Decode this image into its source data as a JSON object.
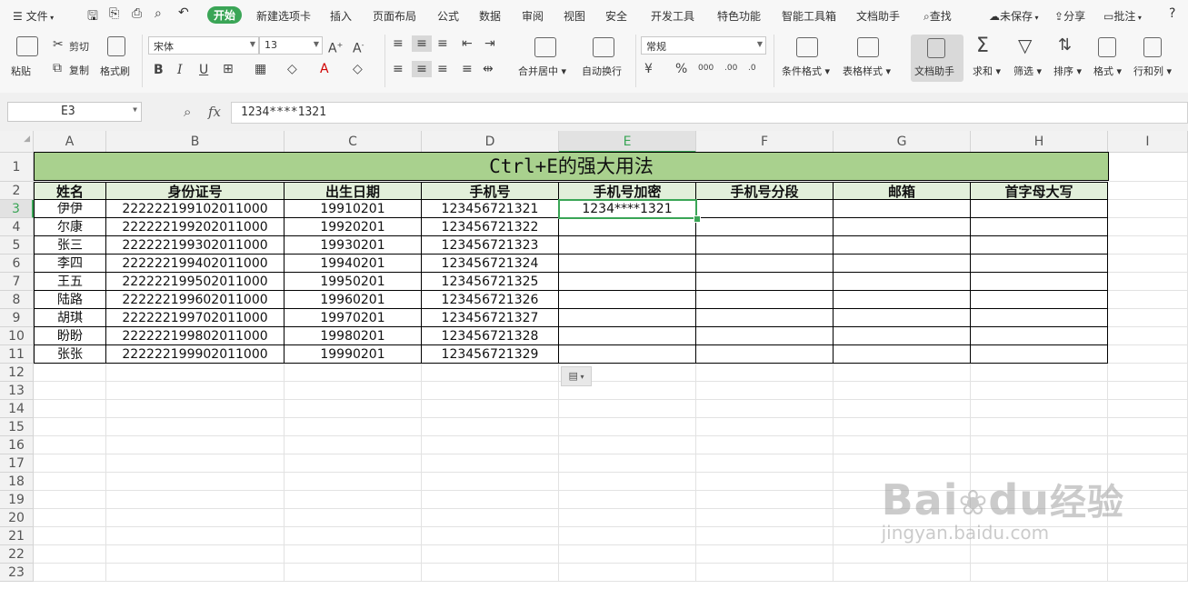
{
  "menubar": {
    "file": "文件",
    "tabs": [
      "开始",
      "新建选项卡",
      "插入",
      "页面布局",
      "公式",
      "数据",
      "审阅",
      "视图",
      "安全",
      "开发工具",
      "特色功能",
      "智能工具箱",
      "文档助手"
    ],
    "search": "查找",
    "unsaved": "未保存",
    "share": "分享",
    "comment": "批注",
    "help": "?"
  },
  "ribbon": {
    "paste": "粘贴",
    "cut": "剪切",
    "copy": "复制",
    "format_painter": "格式刷",
    "font_name": "宋体",
    "font_size": "13",
    "bold": "B",
    "italic": "I",
    "underline": "U",
    "merge_center": "合并居中",
    "wrap_text": "自动换行",
    "number_format": "常规",
    "percent": "%",
    "cond_format": "条件格式",
    "table_style": "表格样式",
    "doc_assistant": "文档助手",
    "sum": "求和",
    "filter": "筛选",
    "sort": "排序",
    "format": "格式",
    "row_col": "行和列"
  },
  "formula_bar": {
    "name_box": "E3",
    "fx": "fx",
    "value": "1234****1321"
  },
  "columns": [
    "A",
    "B",
    "C",
    "D",
    "E",
    "F",
    "G",
    "H",
    "I"
  ],
  "rows": [
    "1",
    "2",
    "3",
    "4",
    "5",
    "6",
    "7",
    "8",
    "9",
    "10",
    "11",
    "12",
    "13",
    "14",
    "15",
    "16",
    "17",
    "18",
    "19",
    "20",
    "21",
    "22",
    "23"
  ],
  "sheet": {
    "title": "Ctrl+E的强大用法",
    "headers": [
      "姓名",
      "身份证号",
      "出生日期",
      "手机号",
      "手机号加密",
      "手机号分段",
      "邮箱",
      "首字母大写"
    ],
    "data": [
      [
        "伊伊",
        "222222199102011000",
        "19910201",
        "123456721321",
        "1234****1321",
        "",
        "",
        ""
      ],
      [
        "尔康",
        "222222199202011000",
        "19920201",
        "123456721322",
        "",
        "",
        "",
        ""
      ],
      [
        "张三",
        "222222199302011000",
        "19930201",
        "123456721323",
        "",
        "",
        "",
        ""
      ],
      [
        "李四",
        "222222199402011000",
        "19940201",
        "123456721324",
        "",
        "",
        "",
        ""
      ],
      [
        "王五",
        "222222199502011000",
        "19950201",
        "123456721325",
        "",
        "",
        "",
        ""
      ],
      [
        "陆路",
        "222222199602011000",
        "19960201",
        "123456721326",
        "",
        "",
        "",
        ""
      ],
      [
        "胡琪",
        "222222199702011000",
        "19970201",
        "123456721327",
        "",
        "",
        "",
        ""
      ],
      [
        "盼盼",
        "222222199802011000",
        "19980201",
        "123456721328",
        "",
        "",
        "",
        ""
      ],
      [
        "张张",
        "222222199902011000",
        "19990201",
        "123456721329",
        "",
        "",
        "",
        ""
      ]
    ],
    "selected_cell": "E3"
  },
  "watermark": {
    "brand": "Bai",
    "brand2": "du",
    "jingyan": "经验",
    "url": "jingyan.baidu.com"
  }
}
